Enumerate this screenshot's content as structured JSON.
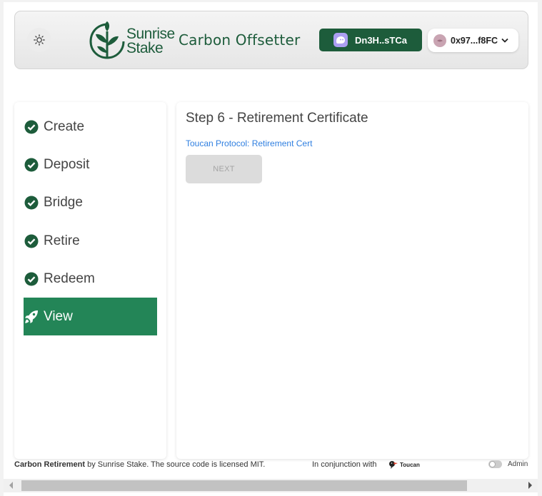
{
  "header": {
    "logo_line1": "Sunrise",
    "logo_line2": "Stake",
    "app_title": "Carbon Offsetter",
    "solana_wallet": "Dn3H..sTCa",
    "eth_wallet": "0x97...f8FC",
    "theme_icon": "sun-icon",
    "brand_color": "#1d5c3b"
  },
  "sidebar": {
    "steps": [
      {
        "label": "Create",
        "icon": "check-circle-icon",
        "status": "done"
      },
      {
        "label": "Deposit",
        "icon": "check-circle-icon",
        "status": "done"
      },
      {
        "label": "Bridge",
        "icon": "check-circle-icon",
        "status": "done"
      },
      {
        "label": "Retire",
        "icon": "check-circle-icon",
        "status": "done"
      },
      {
        "label": "Redeem",
        "icon": "check-circle-icon",
        "status": "done"
      },
      {
        "label": "View",
        "icon": "rocket-icon",
        "status": "active"
      }
    ],
    "active_color": "#238557"
  },
  "main": {
    "title": "Step 6 - Retirement Certificate",
    "cert_link": "Toucan Protocol: Retirement Cert",
    "next_label": "NEXT"
  },
  "footer": {
    "product": "Carbon Retirement",
    "license": " by Sunrise Stake. The source code is licensed MIT.",
    "conjunction": "In conjunction with",
    "partner": "Toucan",
    "admin_label": "Admin"
  }
}
